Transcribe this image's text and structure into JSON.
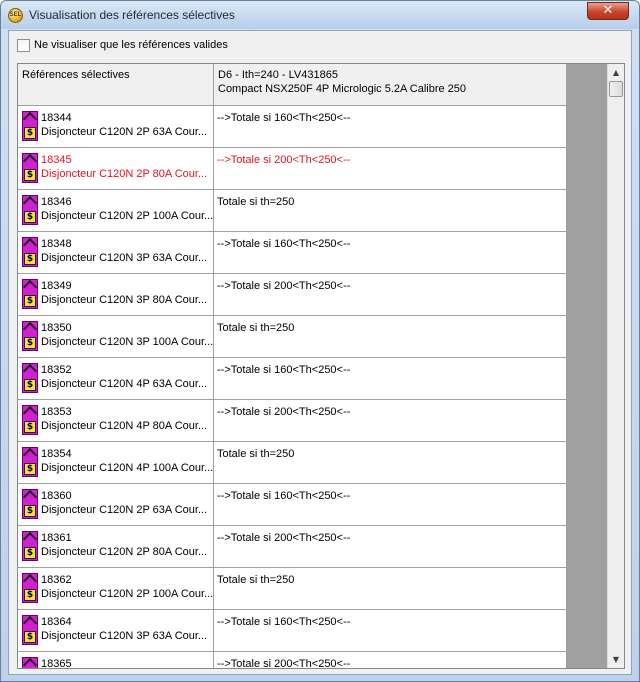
{
  "window": {
    "title": "Visualisation des références sélectives",
    "app_icon_text": "SEL",
    "close_glyph": "✕"
  },
  "filter": {
    "checkbox_label": "Ne visualiser que les références valides",
    "checked": false
  },
  "grid": {
    "headers": {
      "col1": "Références sélectives",
      "col2_line1": "D6 - Ith=240 - LV431865",
      "col2_line2": "Compact NSX250F 4P Micrologic 5.2A Calibre 250"
    },
    "rows": [
      {
        "code": "18344",
        "desc": "Disjoncteur C120N 2P 63A Cour...",
        "value": "-->Totale si 160<Th<250<--",
        "selected": false
      },
      {
        "code": "18345",
        "desc": "Disjoncteur C120N 2P 80A Cour...",
        "value": "-->Totale si 200<Th<250<--",
        "selected": true
      },
      {
        "code": "18346",
        "desc": "Disjoncteur C120N 2P 100A Cour...",
        "value": "Totale si th=250",
        "selected": false
      },
      {
        "code": "18348",
        "desc": "Disjoncteur C120N 3P 63A Cour...",
        "value": "-->Totale si 160<Th<250<--",
        "selected": false
      },
      {
        "code": "18349",
        "desc": "Disjoncteur C120N 3P 80A Cour...",
        "value": "-->Totale si 200<Th<250<--",
        "selected": false
      },
      {
        "code": "18350",
        "desc": "Disjoncteur C120N 3P 100A Cour...",
        "value": "Totale si th=250",
        "selected": false
      },
      {
        "code": "18352",
        "desc": "Disjoncteur C120N 4P 63A Cour...",
        "value": "-->Totale si 160<Th<250<--",
        "selected": false
      },
      {
        "code": "18353",
        "desc": "Disjoncteur C120N 4P 80A Cour...",
        "value": "-->Totale si 200<Th<250<--",
        "selected": false
      },
      {
        "code": "18354",
        "desc": "Disjoncteur C120N 4P 100A Cour...",
        "value": "Totale si th=250",
        "selected": false
      },
      {
        "code": "18360",
        "desc": "Disjoncteur C120N 2P 63A Cour...",
        "value": "-->Totale si 160<Th<250<--",
        "selected": false
      },
      {
        "code": "18361",
        "desc": "Disjoncteur C120N 2P 80A Cour...",
        "value": "-->Totale si 200<Th<250<--",
        "selected": false
      },
      {
        "code": "18362",
        "desc": "Disjoncteur C120N 2P 100A Cour...",
        "value": "Totale si th=250",
        "selected": false
      },
      {
        "code": "18364",
        "desc": "Disjoncteur C120N 3P 63A Cour...",
        "value": "-->Totale si 160<Th<250<--",
        "selected": false
      },
      {
        "code": "18365",
        "desc": "",
        "value": "-->Totale si 200<Th<250<--",
        "selected": false
      }
    ]
  },
  "scrollbar": {
    "up_glyph": "▲",
    "down_glyph": "▼"
  },
  "colors": {
    "selected_text": "#e0141e",
    "icon_background": "#d41ed4"
  }
}
